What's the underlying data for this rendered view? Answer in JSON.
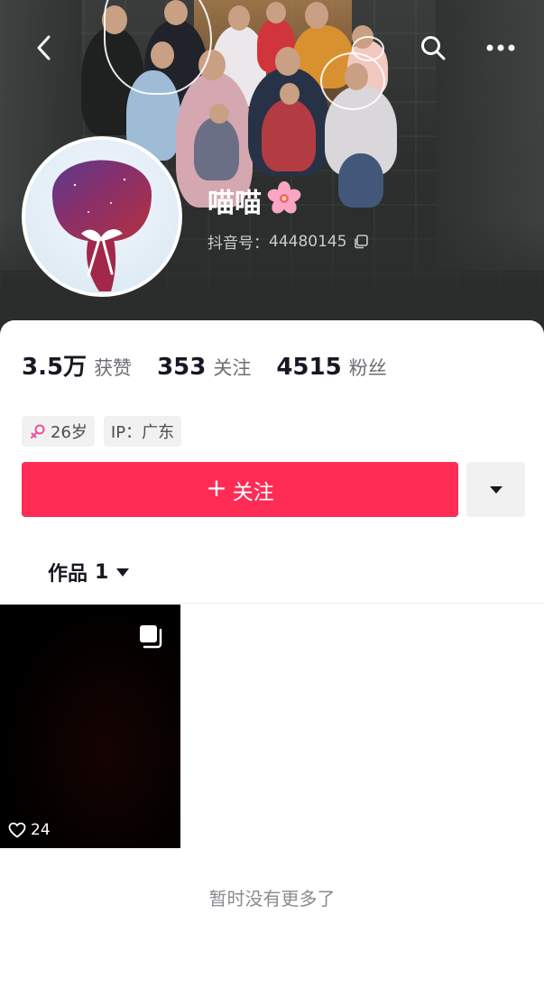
{
  "header": {
    "back_icon": "chevron-left-icon",
    "search_icon": "search-icon",
    "more_icon": "more-horizontal-icon"
  },
  "profile": {
    "name": "喵喵",
    "name_emoji": "🌸",
    "douyin_id_label": "抖音号：",
    "douyin_id": "44480145",
    "copy_icon": "copy-icon"
  },
  "stats": [
    {
      "value": "3.5万",
      "label": "获赞"
    },
    {
      "value": "353",
      "label": "关注"
    },
    {
      "value": "4515",
      "label": "粉丝"
    }
  ],
  "tags": [
    {
      "icon": "female-icon",
      "text": "26岁"
    },
    {
      "text": "IP：广东"
    }
  ],
  "actions": {
    "follow_label": "关注",
    "follow_prefix": "+",
    "more_icon": "caret-down-icon"
  },
  "tabs": {
    "works_label": "作品",
    "works_count": "1"
  },
  "videos": [
    {
      "likes": "24",
      "type_icon": "multi-image-icon",
      "like_icon": "heart-outline-icon"
    }
  ],
  "footer": {
    "end_text": "暂时没有更多了"
  },
  "colors": {
    "accent": "#fe2c55",
    "text_primary": "#161823",
    "text_secondary": "#6c6e74",
    "tag_bg": "#f1f1f2",
    "female_pink": "#f0509a"
  }
}
